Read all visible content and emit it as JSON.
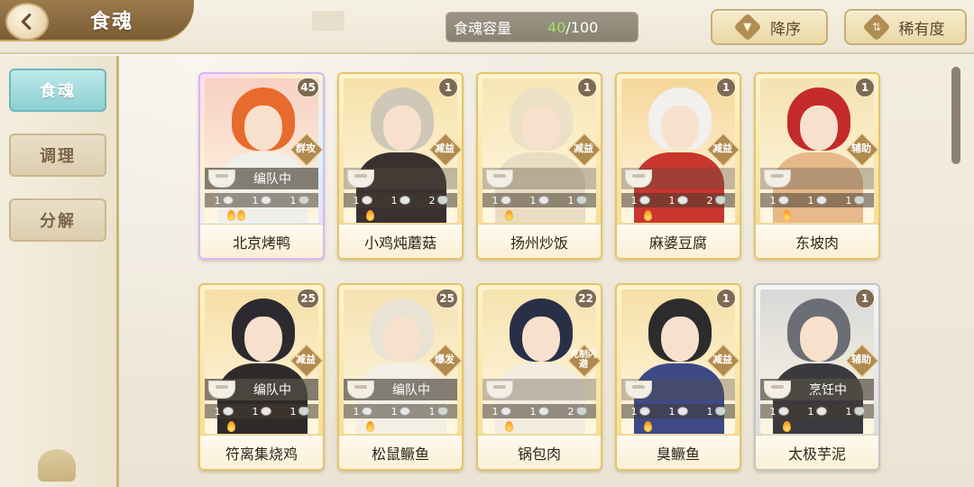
{
  "header": {
    "title": "食魂",
    "capacity": {
      "label": "食魂容量",
      "current": "40",
      "max": "/100"
    },
    "sort_order_label": "降序",
    "sort_key_label": "稀有度"
  },
  "nav": {
    "items": [
      {
        "label": "食魂",
        "active": true
      },
      {
        "label": "调理",
        "active": false
      },
      {
        "label": "分解",
        "active": false
      }
    ]
  },
  "cards": [
    {
      "name": "北京烤鸭",
      "level": "45",
      "role": "群攻",
      "status": "编队中",
      "frame": "rainbow",
      "stats": [
        "1",
        "1",
        "1"
      ],
      "flames": 2,
      "colors": {
        "sky": "#f7d0c4",
        "hair": "#e86a2c",
        "body": "#f1efe9"
      }
    },
    {
      "name": "小鸡炖蘑菇",
      "level": "1",
      "role": "减益",
      "status": "",
      "frame": "gold",
      "stats": [
        "1",
        "1",
        "2"
      ],
      "flames": 1,
      "colors": {
        "sky": "#f6e1a8",
        "hair": "#cfc8b8",
        "body": "#3b3030"
      }
    },
    {
      "name": "扬州炒饭",
      "level": "1",
      "role": "减益",
      "status": "",
      "frame": "gold",
      "stats": [
        "1",
        "1",
        "1"
      ],
      "flames": 1,
      "colors": {
        "sky": "#f7e6b4",
        "hair": "#ece0c6",
        "body": "#e9dcc2"
      }
    },
    {
      "name": "麻婆豆腐",
      "level": "1",
      "role": "减益",
      "status": "",
      "frame": "gold",
      "stats": [
        "1",
        "1",
        "2"
      ],
      "flames": 1,
      "colors": {
        "sky": "#f6d79a",
        "hair": "#f2f0ec",
        "body": "#c8362e"
      }
    },
    {
      "name": "东坡肉",
      "level": "1",
      "role": "辅助",
      "status": "",
      "frame": "gold",
      "stats": [
        "1",
        "1",
        "1"
      ],
      "flames": 1,
      "colors": {
        "sky": "#f4e2b0",
        "hair": "#c42a2a",
        "body": "#e7b88a"
      }
    },
    {
      "name": "符离集烧鸡",
      "level": "25",
      "role": "减益",
      "status": "编队中",
      "frame": "gold",
      "stats": [
        "1",
        "1",
        "1"
      ],
      "flames": 1,
      "colors": {
        "sky": "#f6dfa6",
        "hair": "#2c2a2e",
        "body": "#2f2a2a"
      }
    },
    {
      "name": "松鼠鳜鱼",
      "level": "25",
      "role": "爆发",
      "status": "编队中",
      "frame": "gold",
      "stats": [
        "1",
        "1",
        "1"
      ],
      "flames": 1,
      "colors": {
        "sky": "#f5e2b2",
        "hair": "#e9e3d6",
        "body": "#f3efe4"
      }
    },
    {
      "name": "锅包肉",
      "level": "22",
      "role": "克制闪避",
      "status": "",
      "frame": "gold",
      "stats": [
        "1",
        "1",
        "2"
      ],
      "flames": 1,
      "colors": {
        "sky": "#f6e3ae",
        "hair": "#2a2f48",
        "body": "#f3ece0"
      }
    },
    {
      "name": "臭鳜鱼",
      "level": "1",
      "role": "减益",
      "status": "",
      "frame": "gold",
      "stats": [
        "1",
        "1",
        "1"
      ],
      "flames": 1,
      "colors": {
        "sky": "#f6e0a6",
        "hair": "#2c2c2c",
        "body": "#3d4a86"
      }
    },
    {
      "name": "太极芋泥",
      "level": "1",
      "role": "辅助",
      "status": "烹饪中",
      "frame": "silver",
      "stats": [
        "1",
        "1",
        "1"
      ],
      "flames": 1,
      "colors": {
        "sky": "#d8d8d8",
        "hair": "#6b6e74",
        "body": "#3a3a3e"
      }
    }
  ]
}
